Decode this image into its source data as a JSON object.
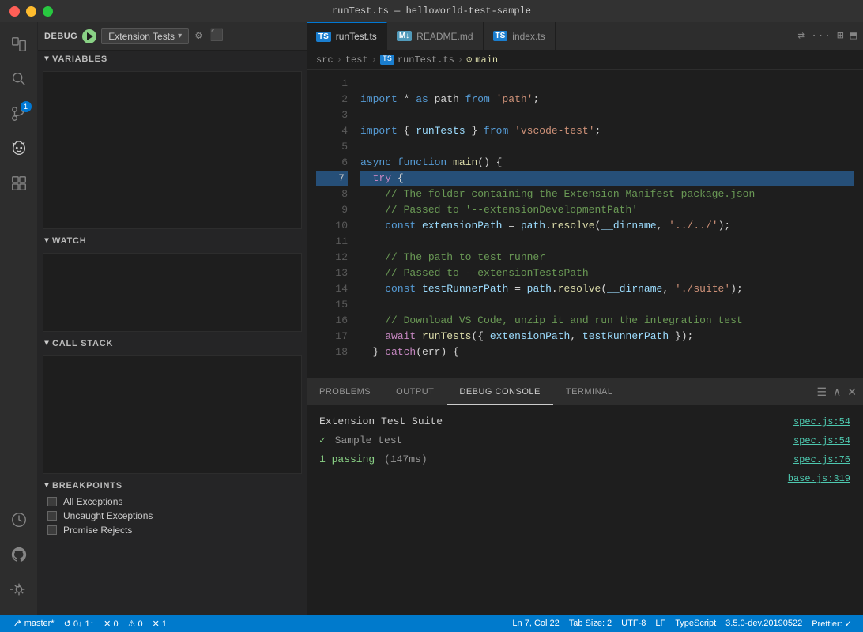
{
  "titleBar": {
    "title": "runTest.ts — helloworld-test-sample"
  },
  "debugToolbar": {
    "label": "DEBUG",
    "config": "Extension Tests",
    "configArrow": "▾"
  },
  "sidebar": {
    "sections": {
      "variables": "VARIABLES",
      "watch": "WATCH",
      "callStack": "CALL STACK",
      "breakpoints": "BREAKPOINTS"
    },
    "breakpoints": [
      "All Exceptions",
      "Uncaught Exceptions",
      "Promise Rejects"
    ]
  },
  "tabs": [
    {
      "label": "runTest.ts",
      "type": "ts",
      "active": true
    },
    {
      "label": "README.md",
      "type": "md",
      "active": false
    },
    {
      "label": "index.ts",
      "type": "ts",
      "active": false
    }
  ],
  "breadcrumb": {
    "src": "src",
    "test": "test",
    "file": "runTest.ts",
    "func": "main"
  },
  "code": [
    {
      "ln": "1",
      "content": ""
    },
    {
      "ln": "2",
      "tokens": [
        {
          "t": "kw",
          "v": "import"
        },
        {
          "t": "punc",
          "v": " * "
        },
        {
          "t": "kw",
          "v": "as"
        },
        {
          "t": "punc",
          "v": " path "
        },
        {
          "t": "kw",
          "v": "from"
        },
        {
          "t": "str",
          "v": " 'path'"
        },
        {
          "t": "punc",
          "v": ";"
        }
      ]
    },
    {
      "ln": "3",
      "content": ""
    },
    {
      "ln": "4",
      "tokens": [
        {
          "t": "kw",
          "v": "import"
        },
        {
          "t": "punc",
          "v": " { "
        },
        {
          "t": "var",
          "v": "runTests"
        },
        {
          "t": "punc",
          "v": " } "
        },
        {
          "t": "kw",
          "v": "from"
        },
        {
          "t": "str",
          "v": " 'vscode-test'"
        },
        {
          "t": "punc",
          "v": ";"
        }
      ]
    },
    {
      "ln": "5",
      "content": ""
    },
    {
      "ln": "6",
      "tokens": [
        {
          "t": "kw",
          "v": "async"
        },
        {
          "t": "punc",
          "v": " "
        },
        {
          "t": "kw",
          "v": "function"
        },
        {
          "t": "punc",
          "v": " "
        },
        {
          "t": "fn",
          "v": "main"
        },
        {
          "t": "punc",
          "v": "() {"
        }
      ]
    },
    {
      "ln": "7",
      "tokens": [
        {
          "t": "punc",
          "v": "  "
        },
        {
          "t": "kw2",
          "v": "try"
        },
        {
          "t": "punc",
          "v": " {"
        }
      ]
    },
    {
      "ln": "8",
      "tokens": [
        {
          "t": "cmt",
          "v": "    // The folder containing the Extension Manifest package.json"
        }
      ]
    },
    {
      "ln": "9",
      "tokens": [
        {
          "t": "cmt",
          "v": "    // Passed to '--extensionDevelopmentPath'"
        }
      ]
    },
    {
      "ln": "10",
      "tokens": [
        {
          "t": "punc",
          "v": "    "
        },
        {
          "t": "kw",
          "v": "const"
        },
        {
          "t": "punc",
          "v": " "
        },
        {
          "t": "var",
          "v": "extensionPath"
        },
        {
          "t": "punc",
          "v": " = "
        },
        {
          "t": "var",
          "v": "path"
        },
        {
          "t": "punc",
          "v": "."
        },
        {
          "t": "fn",
          "v": "resolve"
        },
        {
          "t": "punc",
          "v": "("
        },
        {
          "t": "var",
          "v": "__dirname"
        },
        {
          "t": "str",
          "v": ", '../../'"
        },
        {
          "t": "punc",
          "v": ");"
        }
      ]
    },
    {
      "ln": "11",
      "content": ""
    },
    {
      "ln": "12",
      "tokens": [
        {
          "t": "cmt",
          "v": "    // The path to test runner"
        }
      ]
    },
    {
      "ln": "13",
      "tokens": [
        {
          "t": "cmt",
          "v": "    // Passed to --extensionTestsPath"
        }
      ]
    },
    {
      "ln": "14",
      "tokens": [
        {
          "t": "punc",
          "v": "    "
        },
        {
          "t": "kw",
          "v": "const"
        },
        {
          "t": "punc",
          "v": " "
        },
        {
          "t": "var",
          "v": "testRunnerPath"
        },
        {
          "t": "punc",
          "v": " = "
        },
        {
          "t": "var",
          "v": "path"
        },
        {
          "t": "punc",
          "v": "."
        },
        {
          "t": "fn",
          "v": "resolve"
        },
        {
          "t": "punc",
          "v": "("
        },
        {
          "t": "var",
          "v": "__dirname"
        },
        {
          "t": "str",
          "v": ", './suite'"
        },
        {
          "t": "punc",
          "v": ");"
        }
      ]
    },
    {
      "ln": "15",
      "content": ""
    },
    {
      "ln": "16",
      "tokens": [
        {
          "t": "cmt",
          "v": "    // Download VS Code, unzip it and run the integration test"
        }
      ]
    },
    {
      "ln": "17",
      "tokens": [
        {
          "t": "punc",
          "v": "    "
        },
        {
          "t": "kw2",
          "v": "await"
        },
        {
          "t": "punc",
          "v": " "
        },
        {
          "t": "fn",
          "v": "runTests"
        },
        {
          "t": "punc",
          "v": "({ "
        },
        {
          "t": "var",
          "v": "extensionPath"
        },
        {
          "t": "punc",
          "v": ", "
        },
        {
          "t": "var",
          "v": "testRunnerPath"
        },
        {
          "t": "punc",
          "v": " });"
        }
      ]
    },
    {
      "ln": "18",
      "tokens": [
        {
          "t": "punc",
          "v": "  } "
        },
        {
          "t": "kw2",
          "v": "catch"
        },
        {
          "t": "punc",
          "v": "(err) {"
        }
      ]
    }
  ],
  "panelTabs": [
    "PROBLEMS",
    "OUTPUT",
    "DEBUG CONSOLE",
    "TERMINAL"
  ],
  "activePanelTab": "DEBUG CONSOLE",
  "debugConsole": {
    "suiteName": "Extension Test Suite",
    "checkMark": "✓",
    "testName": "Sample test",
    "passingText": "1 passing",
    "timeText": "(147ms)",
    "refs": {
      "ref1": "spec.js:54",
      "ref2": "spec.js:54",
      "ref3": "spec.js:76",
      "ref4": "base.js:319"
    }
  },
  "statusBar": {
    "branch": "master*",
    "sync": "↺ 0↓ 1↑",
    "errors": "✕ 0",
    "warnings": "⚠ 0",
    "infos": "✕ 1",
    "position": "Ln 7, Col 22",
    "tabSize": "Tab Size: 2",
    "encoding": "UTF-8",
    "lineEnding": "LF",
    "language": "TypeScript",
    "version": "3.5.0-dev.20190522",
    "prettier": "Prettier: ✓"
  },
  "activityIcons": {
    "explorer": "⬜",
    "search": "🔍",
    "sourceControl": "⑂",
    "debug": "🐛",
    "extensions": "⊞",
    "history": "🕐",
    "github": "⊙"
  }
}
